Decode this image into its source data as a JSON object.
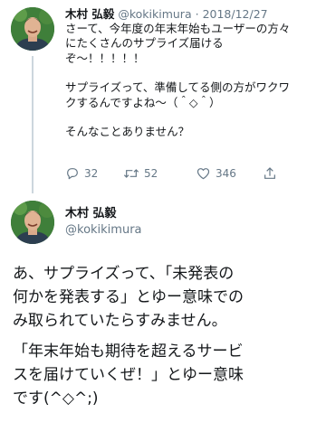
{
  "tweet": {
    "display_name": "木村 弘毅",
    "handle": "@kokikimura",
    "separator": "·",
    "date": "2018/12/27",
    "lines_para1": [
      "さーて、今年度の年末年始もユーザーの方々",
      "にたくさんのサプライズ届ける",
      "ぞ〜！！！！！"
    ],
    "lines_para2": [
      "サプライズって、準備してる側の方がワクワ",
      "クするんですよね〜（＾◇＾）"
    ],
    "lines_para3": [
      "そんなことありません？"
    ],
    "replies": "32",
    "retweets": "52",
    "likes": "346"
  },
  "reply": {
    "display_name": "木村 弘毅",
    "handle": "@kokikimura",
    "lines_para1": [
      "あ、サプライズって、「未発表の",
      "何かを発表する」とゆー意味での",
      "み取られていたらすみません。"
    ],
    "lines_para2": [
      "「年末年始も期待を超えるサービ",
      "スを届けていくぜ！」とゆー意味",
      "です(^◇^;)"
    ]
  },
  "icons": {
    "reply": "reply-icon",
    "retweet": "retweet-icon",
    "like": "like-icon",
    "share": "share-icon",
    "avatar": "avatar"
  },
  "colors": {
    "text": "#14171a",
    "secondary": "#657786",
    "thread_line": "#ccd6dd"
  }
}
